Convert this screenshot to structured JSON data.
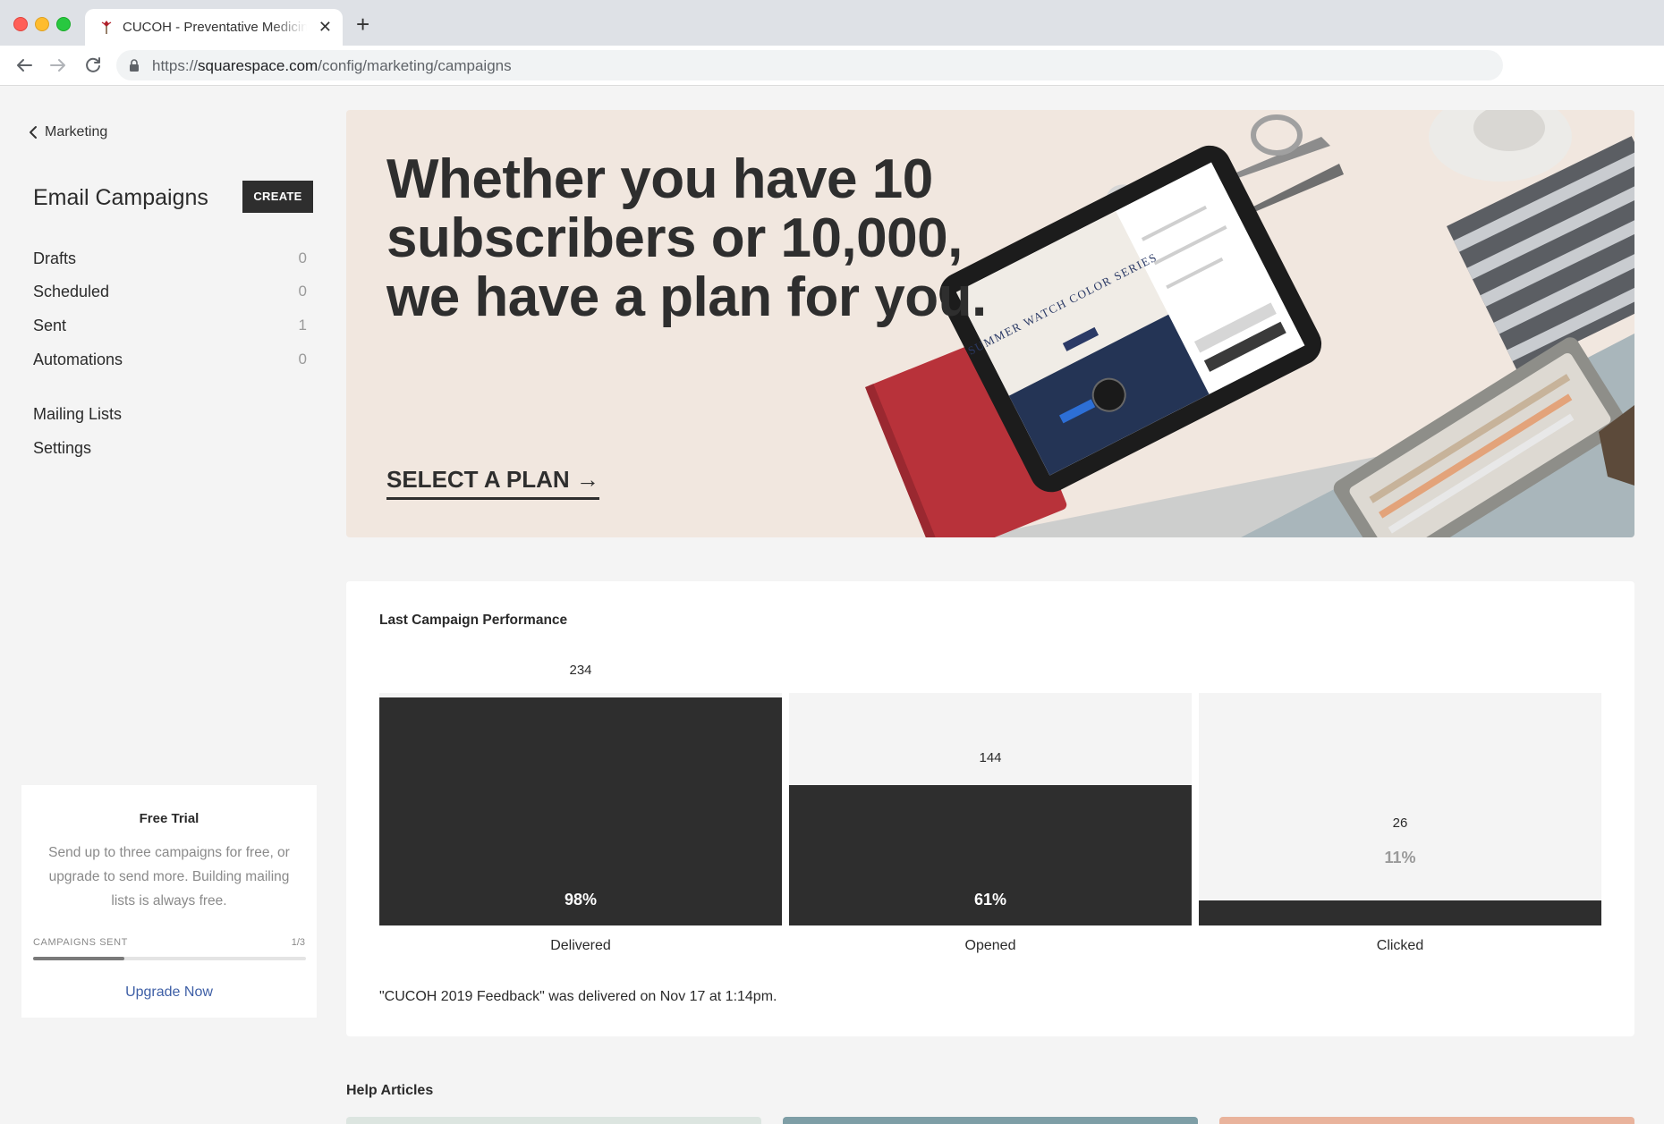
{
  "browser": {
    "tab_title": "CUCOH - Preventative Medicine",
    "tab_close": "✕",
    "new_tab": "+",
    "url_prefix": "https://",
    "url_domain": "squarespace.com",
    "url_path": "/config/marketing/campaigns"
  },
  "sidebar": {
    "back_label": "Marketing",
    "title": "Email Campaigns",
    "create_label": "CREATE",
    "items": [
      {
        "label": "Drafts",
        "count": "0"
      },
      {
        "label": "Scheduled",
        "count": "0"
      },
      {
        "label": "Sent",
        "count": "1"
      },
      {
        "label": "Automations",
        "count": "0"
      }
    ],
    "links": [
      {
        "label": "Mailing Lists"
      },
      {
        "label": "Settings"
      }
    ],
    "trial": {
      "title": "Free Trial",
      "text": "Send up to three campaigns for free, or upgrade to send more. Building mailing lists is always free.",
      "progress_label": "CAMPAIGNS SENT",
      "progress_count": "1/3",
      "progress_fraction": 0.3333,
      "upgrade_label": "Upgrade Now"
    }
  },
  "hero": {
    "headline": "Whether you have 10 subscribers or 10,000, we have a plan for you.",
    "cta_label": "SELECT A PLAN →",
    "tablet_text": "SUMMER WATCH COLOR SERIES"
  },
  "performance": {
    "title": "Last Campaign Performance",
    "note": "\"CUCOH 2019 Feedback\" was delivered on Nov 17 at 1:14pm."
  },
  "chart_data": {
    "type": "bar",
    "categories": [
      "Delivered",
      "Opened",
      "Clicked"
    ],
    "values": [
      234,
      144,
      26
    ],
    "percent_labels": [
      "98%",
      "61%",
      "11%"
    ],
    "ylim": [
      0,
      239
    ],
    "grid": false,
    "colors": {
      "bar": "#2e2e2e",
      "track": "#f4f4f4"
    }
  },
  "help": {
    "title": "Help Articles",
    "card_colors": [
      "#dce5e0",
      "#7e9ea6",
      "#e9b39c"
    ]
  },
  "colors": {
    "accent_link": "#3e5fa6",
    "dark": "#2e2e2e"
  }
}
